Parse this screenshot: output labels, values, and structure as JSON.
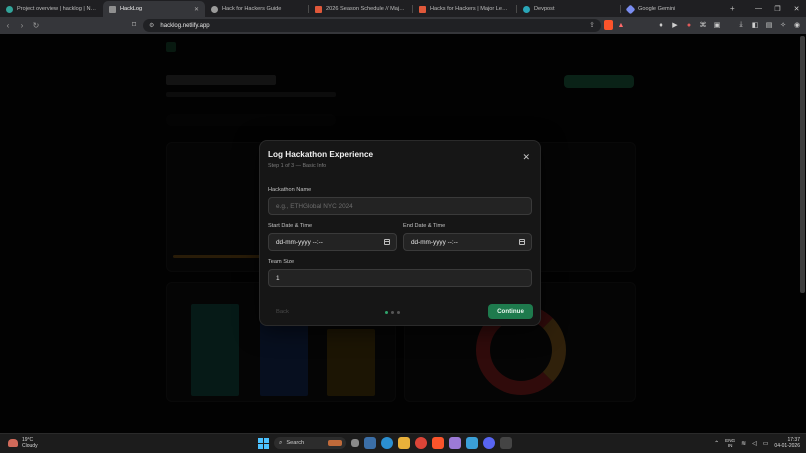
{
  "browser": {
    "tabs": [
      {
        "label": "Project overview | hacklog | Netlify",
        "color": "#32a49a",
        "active": false
      },
      {
        "label": "HackLog",
        "color": "#8f8f8f",
        "active": true
      },
      {
        "label": "Hack for Hackers Guide",
        "color": "#9b9b9b",
        "active": false
      },
      {
        "label": "2026 Season Schedule // Major Leag",
        "color": "#e0583a",
        "active": false
      },
      {
        "label": "Hacks for Hackers | Major League Ha",
        "color": "#e0583a",
        "active": false
      },
      {
        "label": "Devpost",
        "color": "#2aa6b8",
        "active": false
      },
      {
        "label": "Google Gemini",
        "color": "#7a8df0",
        "active": false
      }
    ],
    "url": "hacklog.netlify.app",
    "icons": {
      "back": "arrow-left-icon",
      "forward": "arrow-right-icon",
      "reload": "reload-icon",
      "bookmark": "bookmark-icon"
    }
  },
  "modal": {
    "title": "Log Hackathon Experience",
    "step": "Step 1 of 3 — Basic Info",
    "close_icon": "close-icon",
    "fields": {
      "name_label": "Hackathon Name",
      "name_placeholder": "e.g., ETHGlobal NYC 2024",
      "start_label": "Start Date & Time",
      "start_value": "dd-mm-yyyy --:--",
      "end_label": "End Date & Time",
      "end_value": "dd-mm-yyyy --:--",
      "team_label": "Team Size",
      "team_value": "1"
    },
    "back_label": "Back",
    "continue_label": "Continue",
    "steps_total": 3,
    "current_step": 1,
    "accent": "#1e7a4d"
  },
  "taskbar": {
    "weather_temp": "19°C",
    "weather_desc": "Cloudy",
    "search_label": "Search",
    "lang_line1": "ENG",
    "lang_line2": "IN",
    "time": "17:37",
    "date": "04-01-2026"
  }
}
